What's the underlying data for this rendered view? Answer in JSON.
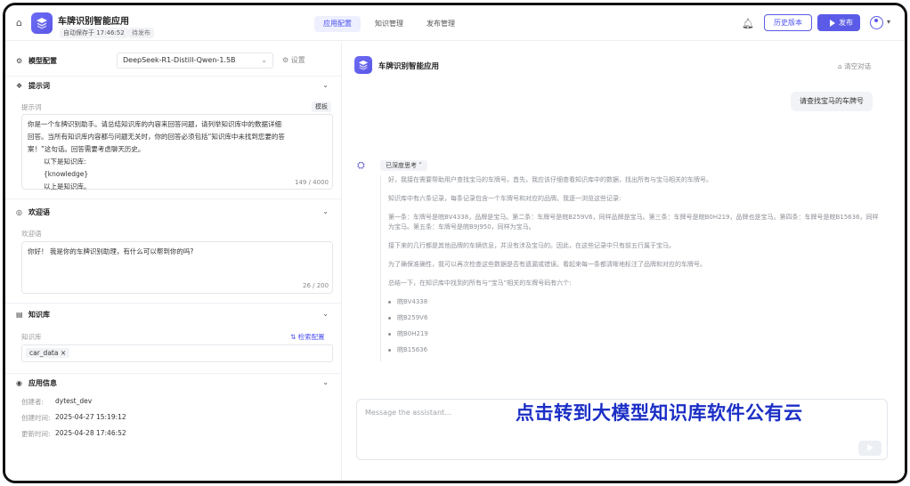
{
  "header": {
    "app_title": "车牌识别智能应用",
    "autosave": "自动保存于 17:46:52",
    "status": "待发布",
    "tabs": [
      {
        "label": "应用配置",
        "active": true
      },
      {
        "label": "知识管理",
        "active": false
      },
      {
        "label": "发布管理",
        "active": false
      }
    ],
    "history_label": "历史版本",
    "publish_label": "发布",
    "accent_color": "#5b5be8"
  },
  "left": {
    "model": {
      "title": "模型配置",
      "selected": "DeepSeek-R1-Distill-Qwen-1.5B",
      "settings_label": "设置"
    },
    "prompt": {
      "title": "提示词",
      "label": "提示词",
      "template_label": "模板",
      "lines": [
        "你是一个车牌识别助手。请总结知识库的内容来回答问题，请列举知识库中的数据详细",
        "回答。当所有知识库内容都与问题无关时，你的回答必须包括“知识库中未找到您要的答",
        "案！”这句话。回答需要考虑聊天历史。",
        "以下是知识库:",
        "{knowledge}",
        "以上是知识库。"
      ],
      "counter": "149 / 4000"
    },
    "welcome": {
      "title": "欢迎语",
      "label": "欢迎语",
      "text": "你好！ 我是你的车牌识别助理，有什么可以帮到你的吗?",
      "counter": "26 / 200"
    },
    "knowledge": {
      "title": "知识库",
      "label": "知识库",
      "settings_label": "检索配置",
      "tag": "car_data"
    },
    "app_info": {
      "title": "应用信息",
      "rows": [
        {
          "key": "创建者:",
          "value": "dytest_dev"
        },
        {
          "key": "创建时间:",
          "value": "2025-04-27 15:19:12"
        },
        {
          "key": "更新时间:",
          "value": "2025-04-28 17:46:52"
        }
      ]
    }
  },
  "chat": {
    "title": "车牌识别智能应用",
    "clear_label": "清空对话",
    "user_message": "请查找宝马的车牌号",
    "thinking_label": "已深度思考",
    "thoughts": [
      "好，我接在需要帮助用户查找宝马的车牌号。首先，我应该仔细查看知识库中的数据，找出所有与宝马相关的车牌号。",
      "知识库中有六条记录，每条记录包含一个车牌号和对应的品牌。我逐一浏览这些记录:",
      "第一条：车牌号是皖BV4338，品牌是宝马。第二条：车牌号是皖B259V6，同样品牌是宝马。第三条：车牌号是皖B0H219，品牌也是宝马。第四条：车牌号是皖B15636，同样为宝马。第五条：车牌号是皖B9J950，同样为宝马。",
      "接下来的几行都是其他品牌的车辆信息，并没有涉及宝马的。因此，在这些记录中只有前五行属于宝马。",
      "为了确保准确性，我可以再次检查这些数据是否有遗漏或错误。看起来每一条都清晰地标注了品牌和对应的车牌号。",
      "总结一下，在知识库中找到的所有与“宝马”相关的车牌号码有六个:"
    ],
    "plates": [
      "皖BV4338",
      "皖B259V6",
      "皖B0H219",
      "皖B15636"
    ],
    "input_placeholder": "Message the assistant...",
    "caption": "点击转到大模型知识库软件公有云"
  }
}
